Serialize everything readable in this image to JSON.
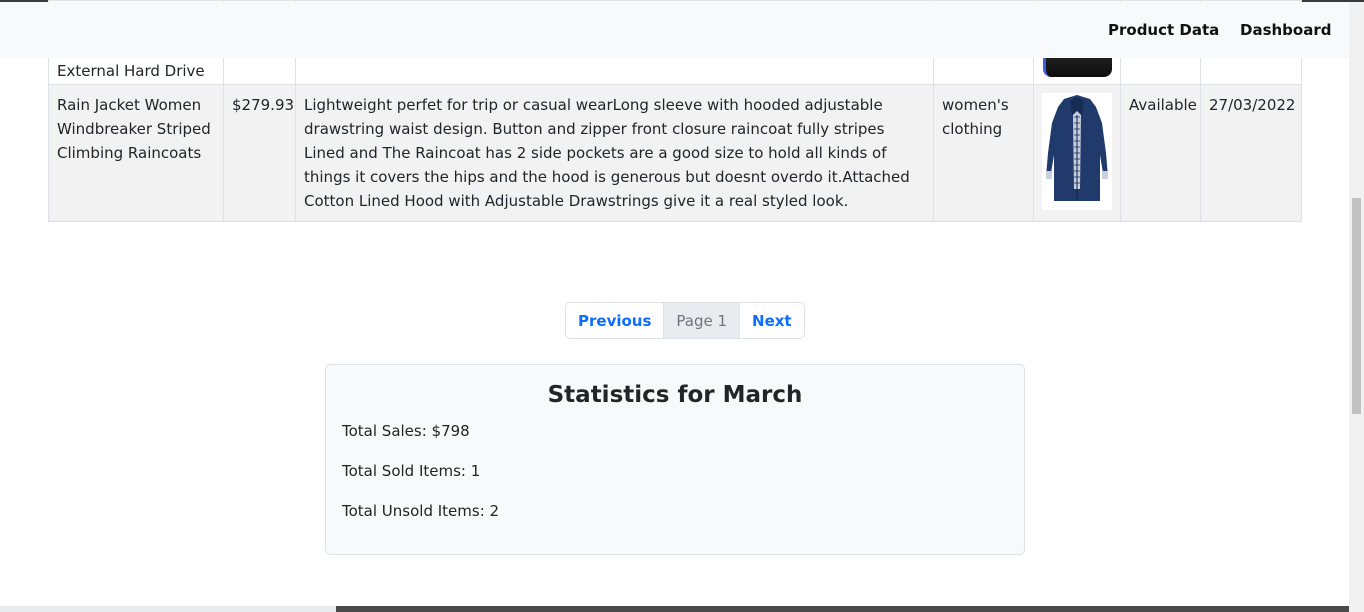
{
  "navbar": {
    "links": [
      "Product Data",
      "Dashboard"
    ]
  },
  "table": {
    "rows": [
      {
        "name": "External Hard Drive",
        "price": "",
        "description": "",
        "category": "",
        "status": "",
        "date": ""
      },
      {
        "name": "Rain Jacket Women Windbreaker Striped Climbing Raincoats",
        "price": "$279.93",
        "description": "Lightweight perfet for trip or casual wearLong sleeve with hooded adjustable drawstring waist design. Button and zipper front closure raincoat fully stripes Lined and The Raincoat has 2 side pockets are a good size to hold all kinds of things it covers the hips and the hood is generous but doesnt overdo it.Attached Cotton Lined Hood with Adjustable Drawstrings give it a real styled look.",
        "category": "women's clothing",
        "status": "Available",
        "date": "27/03/2022"
      }
    ]
  },
  "pagination": {
    "previous": "Previous",
    "current": "Page 1",
    "next": "Next"
  },
  "stats": {
    "title": "Statistics for March",
    "total_sales": "Total Sales: $798",
    "total_sold": "Total Sold Items: 1",
    "total_unsold": "Total Unsold Items: 2"
  },
  "colors": {
    "link_blue": "#0d6efd",
    "navbar_bg": "#f8f9fa",
    "row_stripe": "#f2f2f2",
    "jacket_navy": "#1f3a6b"
  }
}
